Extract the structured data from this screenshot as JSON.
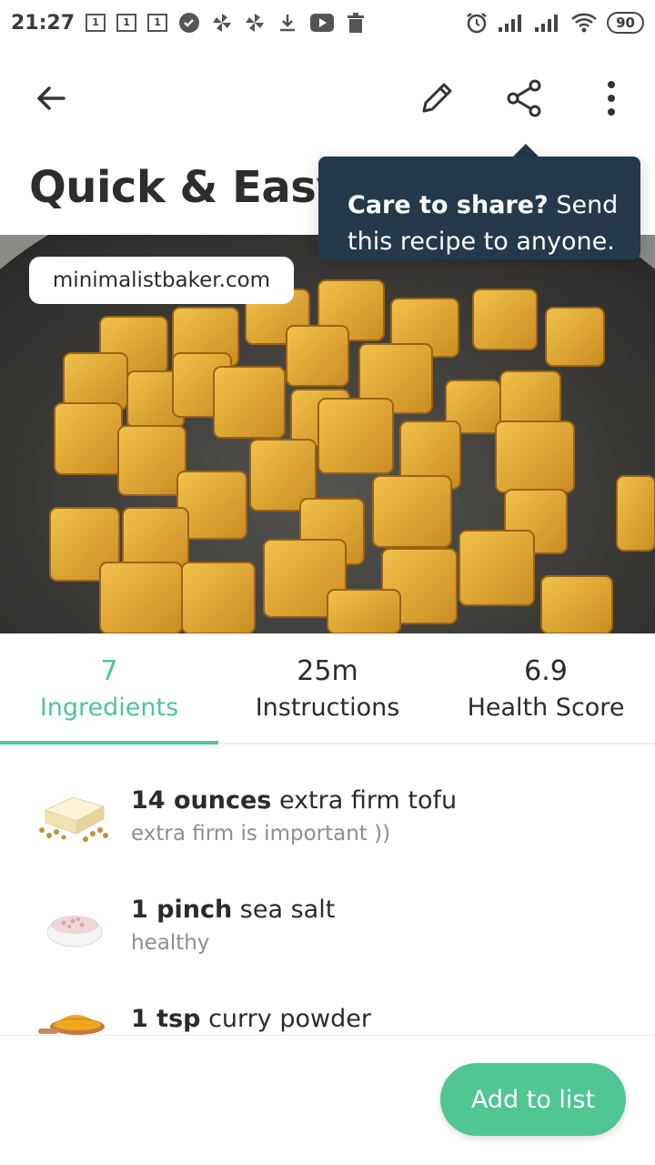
{
  "status_bar": {
    "time": "21:27",
    "notif_box_label": "1",
    "battery": "90",
    "icons_left": [
      "calendar-icon",
      "calendar-icon",
      "calendar-icon",
      "check-circle-icon",
      "pinwheel-icon",
      "pinwheel-icon",
      "download-icon",
      "youtube-icon",
      "trash-icon"
    ],
    "icons_right": [
      "alarm-icon",
      "signal-icon",
      "signal-icon",
      "wifi-icon",
      "battery-icon"
    ]
  },
  "toolbar": {
    "icons": [
      "back-arrow-icon",
      "pencil-icon",
      "share-icon",
      "more-vert-icon"
    ]
  },
  "recipe": {
    "title": "Quick & Easy",
    "source": "minimalistbaker.com"
  },
  "tooltip": {
    "bold": "Care to share?",
    "line1_rest": " Send",
    "line2": "this recipe to anyone."
  },
  "tabs": [
    {
      "value": "7",
      "label": "Ingredients",
      "active": true
    },
    {
      "value": "25m",
      "label": "Instructions",
      "active": false
    },
    {
      "value": "6.9",
      "label": "Health Score",
      "active": false
    }
  ],
  "ingredients": [
    {
      "amount": "14 ounces",
      "name": " extra firm tofu",
      "note": "extra firm is important ))",
      "icon": "tofu-image"
    },
    {
      "amount": "1 pinch",
      "name": " sea salt",
      "note": "healthy",
      "icon": "salt-image"
    },
    {
      "amount": "1 tsp",
      "name": " curry powder",
      "note": "",
      "icon": "curry-powder-image"
    }
  ],
  "bottom": {
    "add_to_list": "Add to list"
  },
  "colors": {
    "accent": "#4fc693",
    "tooltip_bg": "#25394d",
    "text": "#2b2b2b",
    "muted": "#8d8d8d"
  }
}
